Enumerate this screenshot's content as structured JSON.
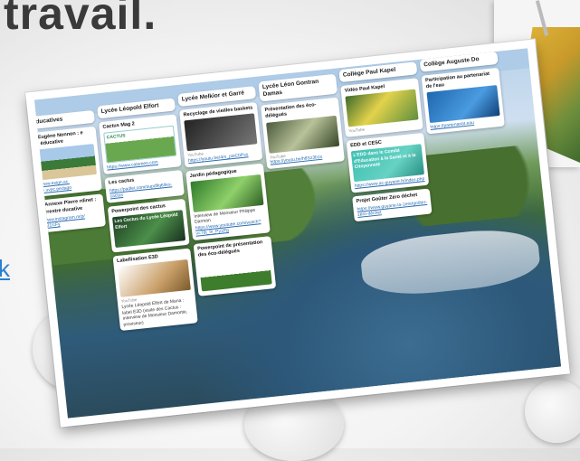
{
  "slide": {
    "title": "travail.",
    "link_text": "k"
  },
  "board": {
    "columns": [
      {
        "heading": "ires éducatives",
        "cards": [
          {
            "title": "ollège Eugène Nonnon : e marine éducative",
            "thumb": "th-beach",
            "link": "https://www.esign.ac. m/bas/je.vvpc.pedago"
          },
          {
            "title": "ollège Annexe Pierre rdinet : Aire terrestre ducative",
            "link": "https://www.instagram.m/p/ wqeu/C31/cFy"
          }
        ]
      },
      {
        "heading": "Lycée Léopold Elfort",
        "cards": [
          {
            "title": "Cactus Mag 2",
            "thumb": "th-cactus",
            "thumb_text": "CACTUS",
            "link": "https://www.calameo.com"
          },
          {
            "title": "Les cactus",
            "link": "https://padlet.com/oupdflq6/les-cactus"
          },
          {
            "title": "Powerpoint des cactus",
            "thumb": "th-pptc",
            "thumb_text": "Les Cactus du Lycée Léopold Elfort"
          },
          {
            "title": "Labellisation E3D",
            "thumb": "th-label",
            "source": "YouTube",
            "text": "Lycée Léopold Elfort de Mana : label E3D (visite des Cactus : interview de Monsieur Damortie, proviseur)"
          }
        ]
      },
      {
        "heading": "Lycée Melkior et Garré",
        "cards": [
          {
            "title": "Recyclage de vieilles baskets",
            "thumb": "th-video",
            "source": "YouTube",
            "link": "https://youtu.be/4m_pioCbPss"
          },
          {
            "title": "Jardin pédagogique",
            "thumb": "th-garden",
            "text": "Interview de Monsieur Philippe Darman",
            "link": "https://www.youtube.com/watch?v=76t_lh_Py1Pg"
          },
          {
            "title": "Powerpoint de présentation des éco-délégués",
            "thumb": "th-ppt2"
          }
        ]
      },
      {
        "heading": "Lycée Léon Gontran Damas",
        "cards": [
          {
            "title": "Présentation des éco-délégués",
            "thumb": "th-boys",
            "source": "YouTube",
            "link": "https://youtu.be/h8Sz3b1s"
          }
        ]
      },
      {
        "heading": "Collège Paul Kapel",
        "cards": [
          {
            "title": "Vidéo Paul Kapel",
            "thumb": "th-kids",
            "source": "YouTube"
          },
          {
            "title": "EDD et CESC",
            "thumb": "th-cesc",
            "thumb_text": "L'EDD dans le Comité d'Education à la Santé et à la Citoyenneté",
            "link": "https://www.ac-guyane.fr/index.php"
          },
          {
            "title": "Projet Goûter Zéro déchet",
            "link": "https://www.guyane-la-1ere/goûter-zéro-déchet"
          }
        ]
      },
      {
        "heading": "Collège Auguste Do",
        "cards": [
          {
            "title": "Participation au partenariat de l'eau",
            "thumb": "th-blue",
            "link": "https://partenariat.eau"
          }
        ]
      }
    ]
  }
}
